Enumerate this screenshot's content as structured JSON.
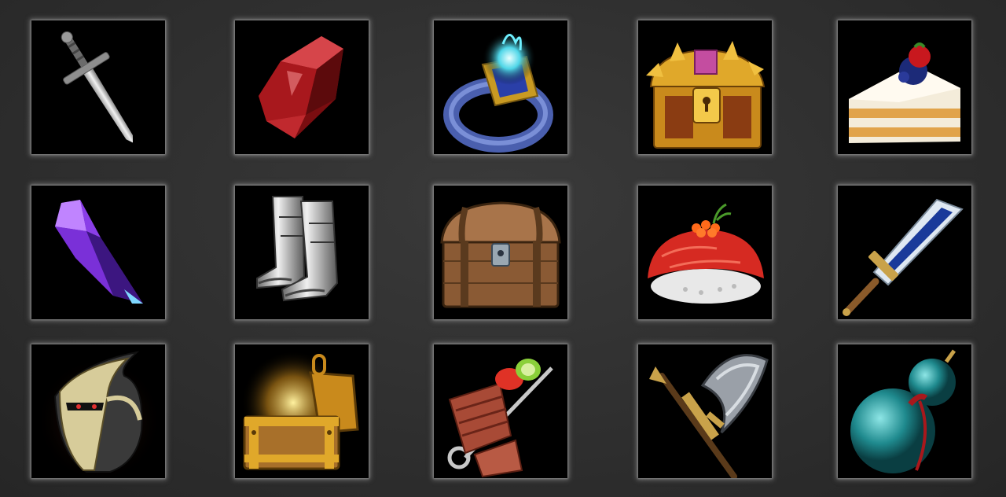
{
  "inventory": {
    "rows": 3,
    "columns": 5,
    "slots": [
      {
        "item": "sword",
        "icon": "sword-icon"
      },
      {
        "item": "red-crystal",
        "icon": "red-crystal-icon"
      },
      {
        "item": "magic-ring",
        "icon": "magic-ring-icon"
      },
      {
        "item": "golden-treasure-chest",
        "icon": "golden-chest-icon"
      },
      {
        "item": "cake-slice",
        "icon": "cake-slice-icon"
      },
      {
        "item": "purple-crystal",
        "icon": "purple-crystal-icon"
      },
      {
        "item": "armored-boots",
        "icon": "armored-boots-icon"
      },
      {
        "item": "wooden-chest",
        "icon": "wooden-chest-icon"
      },
      {
        "item": "salmon-nigiri",
        "icon": "sushi-icon"
      },
      {
        "item": "greatsword",
        "icon": "greatsword-icon"
      },
      {
        "item": "knight-helmet",
        "icon": "helmet-icon"
      },
      {
        "item": "open-treasure-chest",
        "icon": "open-chest-icon"
      },
      {
        "item": "meat-skewer",
        "icon": "meat-skewer-icon"
      },
      {
        "item": "battle-axe",
        "icon": "battle-axe-icon"
      },
      {
        "item": "gourd-flask",
        "icon": "gourd-icon"
      }
    ]
  },
  "colors": {
    "background": "#2f2f2f",
    "slot_background": "#000000",
    "slot_glow": "#aaaaaa"
  }
}
